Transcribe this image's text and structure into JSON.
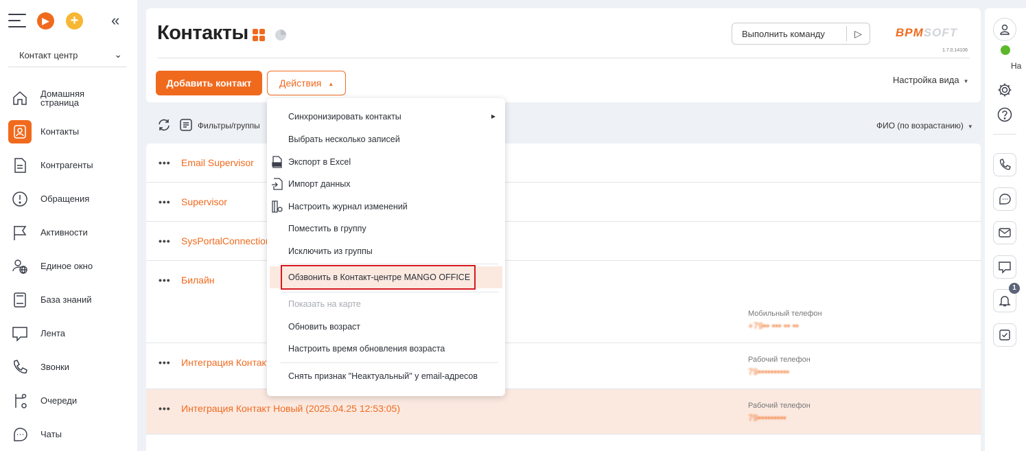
{
  "sidebar": {
    "workspace": "Контакт центр",
    "items": [
      {
        "label": "Домашняя страница",
        "icon": "home-icon"
      },
      {
        "label": "Контакты",
        "icon": "contact-icon",
        "active": true
      },
      {
        "label": "Контрагенты",
        "icon": "document-icon"
      },
      {
        "label": "Обращения",
        "icon": "alert-icon"
      },
      {
        "label": "Активности",
        "icon": "flag-icon"
      },
      {
        "label": "Единое окно",
        "icon": "user-globe-icon"
      },
      {
        "label": "База знаний",
        "icon": "book-icon"
      },
      {
        "label": "Лента",
        "icon": "chat-bubble-icon"
      },
      {
        "label": "Звонки",
        "icon": "phone-icon"
      },
      {
        "label": "Очереди",
        "icon": "queue-icon"
      },
      {
        "label": "Чаты",
        "icon": "chats-icon"
      }
    ]
  },
  "header": {
    "title": "Контакты",
    "command_placeholder": "Выполнить команду",
    "logo_left": "BPM",
    "logo_right": "SOFT",
    "version": "1.7.0.14106",
    "add_button": "Добавить контакт",
    "actions_button": "Действия",
    "view_settings": "Настройка вида"
  },
  "filters": {
    "label": "Фильтры/группы",
    "sort": "ФИО (по возрастанию)"
  },
  "rows": [
    {
      "name": "Email Supervisor"
    },
    {
      "name": "Supervisor"
    },
    {
      "name": "SysPortalConnection"
    },
    {
      "name": "Билайн",
      "phone_label": "Мобильный телефон",
      "phone": "+79•• ••• •• ••"
    },
    {
      "name": "Интеграция Контакт",
      "phone_label": "Рабочий телефон",
      "phone": "79••••••••••"
    },
    {
      "name": "Интеграция Контакт Новый (2025.04.25 12:53:05)",
      "phone_label": "Рабочий телефон",
      "phone": "79•••••••••"
    }
  ],
  "dropdown": {
    "items": [
      {
        "label": "Синхронизировать контакты",
        "submenu": true
      },
      {
        "label": "Выбрать несколько записей"
      },
      {
        "label": "Экспорт в Excel",
        "icon": "excel-export-icon"
      },
      {
        "label": "Импорт данных",
        "icon": "import-icon"
      },
      {
        "label": "Настроить журнал изменений",
        "icon": "journal-settings-icon"
      },
      {
        "label": "Поместить в группу"
      },
      {
        "label": "Исключить из группы"
      },
      {
        "label": "Обзвонить в Контакт-центре MANGO OFFICE",
        "highlighted": true
      },
      {
        "label": "Показать на карте",
        "disabled": true
      },
      {
        "label": "Обновить возраст"
      },
      {
        "label": "Настроить время обновления возраста"
      },
      {
        "label": "Снять признак \"Неактуальный\" у email-адресов"
      }
    ]
  },
  "rightbar": {
    "status_text": "На",
    "notification_count": "1"
  },
  "colors": {
    "accent": "#f06a1e",
    "highlight_row": "#fbe9e0",
    "red_frame": "#d7191f",
    "online": "#5cb82a"
  }
}
